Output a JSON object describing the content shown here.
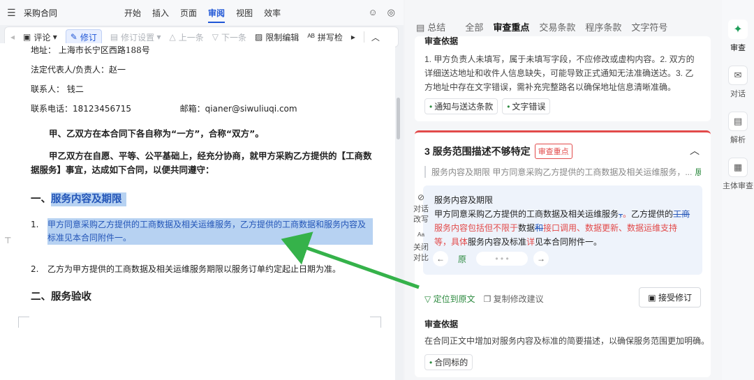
{
  "window": {
    "title": "采购合同",
    "menu_icon": "menu-icon"
  },
  "menu_tabs": [
    {
      "label": "开始"
    },
    {
      "label": "插入"
    },
    {
      "label": "页面"
    },
    {
      "label": "审阅",
      "active": true
    },
    {
      "label": "视图"
    },
    {
      "label": "效率"
    }
  ],
  "ribbon": {
    "comment": "评论",
    "revise": "修订",
    "revise_settings": "修订设置",
    "prev": "上一条",
    "next": "下一条",
    "restrict": "限制编辑",
    "spell": "拼写检"
  },
  "doc": {
    "address": "地址：  上海市长宁区西路188号",
    "rep": "法定代表人/负责人：赵一",
    "contact": "联系人：  钱二",
    "phone_label": "联系电话：",
    "phone": "18123456715",
    "email_label": "邮箱：",
    "email": "qianer@siwuliuqi.com",
    "p1": "甲、乙双方在本合同下各自称为“一方”，合称“双方”。",
    "p2": "甲乙双方在自愿、平等、公平基础上，经充分协商，就甲方采购乙方提供的【工商数据服务】事宜，达成如下合同，以便共同遵守：",
    "h1": "一、服务内容及期限",
    "item1_num": "1.",
    "item1": "甲方同意采购乙方提供的工商数据及相关运维服务，乙方提供的工商数据和服务内容及标准见本合同附件一。",
    "item2_num": "2.",
    "item2": "乙方为甲方提供的工商数据及相关运维服务期限以服务订单约定起止日期为准。",
    "h2": "二、服务验收"
  },
  "panel": {
    "tabs": [
      {
        "label": "总结"
      },
      {
        "label": "全部"
      },
      {
        "label": "审查重点",
        "active": true
      },
      {
        "label": "交易条款"
      },
      {
        "label": "程序条款"
      },
      {
        "label": "文字符号"
      }
    ],
    "card1": {
      "caption": "审查依据",
      "text": "1. 甲方负责人未填写，属于未填写字段，不应修改或虚构内容。2. 双方的详细送达地址和收件人信息缺失，可能导致正式通知无法准确送达。3. 乙方地址中存在文字错误，需补充完整路名以确保地址信息清晰准确。",
      "tags": [
        "通知与送达条款",
        "文字错误"
      ]
    },
    "card2": {
      "title": "3 服务范围描述不够特定",
      "badge": "审查重点",
      "quote": "服务内容及期限 甲方同意采购乙方提供的工商数据及相关运维服务，...",
      "expand": "展开",
      "rev_title": "服务内容及期限",
      "rev_a": "甲方同意采购乙方提供的工商数据及相关运维服务",
      "rev_del1": "，",
      "rev_ins1": "。",
      "rev_b": "乙方提供的",
      "rev_del2": "工商",
      "rev_ins2": "服务内容包括但不限于",
      "rev_c": "数据",
      "rev_del3": "和",
      "rev_ins3": "接口调用、数据更新、数据运维支持等，具体",
      "rev_d": "服务内容及标准",
      "rev_ins4": "详",
      "rev_e": "见本合同附件一。",
      "nav_orig": "原",
      "locate": "定位到原文",
      "copy": "复制修改建议",
      "accept": "接受修订",
      "basis_title": "审查依据",
      "basis_text": "在合同正文中增加对服务内容及标准的简要描述，以确保服务范围更加明确。",
      "basis_tags": [
        "合同标的"
      ]
    },
    "side_tools": {
      "rewrite": "对话改写",
      "close_compare": "关闭对比"
    }
  },
  "rsidebar": [
    {
      "label": "审查",
      "icon": "sparkle-icon",
      "active": true
    },
    {
      "label": "对话",
      "icon": "chat-icon"
    },
    {
      "label": "解析",
      "icon": "parse-icon"
    },
    {
      "label": "主体审查",
      "icon": "building-icon"
    }
  ],
  "colors": {
    "accent": "#1f56d6",
    "green": "#2c8a3f",
    "red": "#e24a4a",
    "highlight": "#b7d2f2"
  }
}
